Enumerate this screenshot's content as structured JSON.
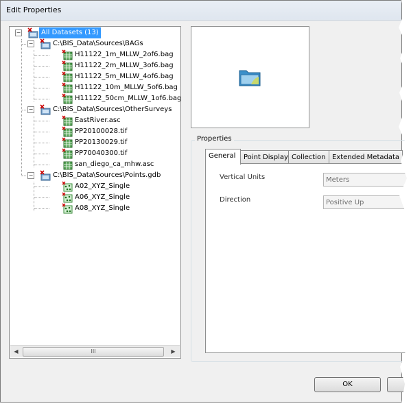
{
  "window": {
    "title": "Edit Properties"
  },
  "tree": {
    "root": {
      "label": "All Datasets (13)",
      "expanded": true,
      "selected": true
    },
    "groups": [
      {
        "label": "C:\\BIS_Data\\Sources\\BAGs",
        "expanded": true,
        "items": [
          "H11122_1m_MLLW_2of6.bag",
          "H11122_2m_MLLW_3of6.bag",
          "H11122_5m_MLLW_4of6.bag",
          "H11122_10m_MLLW_5of6.bag",
          "H11122_50cm_MLLW_1of6.bag"
        ],
        "item_icon": "raster-grid-icon"
      },
      {
        "label": "C:\\BIS_Data\\Sources\\OtherSurveys",
        "expanded": true,
        "items": [
          "EastRiver.asc",
          "PP20100028.tif",
          "PP20130029.tif",
          "PP70040300.tif",
          "san_diego_ca_mhw.asc"
        ],
        "item_icon": "raster-grid-icon"
      },
      {
        "label": "C:\\BIS_Data\\Sources\\Points.gdb",
        "expanded": true,
        "items": [
          "A02_XYZ_Single",
          "A06_XYZ_Single",
          "A08_XYZ_Single"
        ],
        "item_icon": "point-layer-icon"
      }
    ],
    "scrollbar_grip": "III"
  },
  "properties": {
    "group_title": "Properties",
    "tabs": [
      "General",
      "Point Display",
      "Collection",
      "Extended Metadata"
    ],
    "active_tab": 0,
    "fields": [
      {
        "label": "Vertical Units",
        "value": "Meters"
      },
      {
        "label": "Direction",
        "value": "Positive Up"
      }
    ]
  },
  "buttons": {
    "ok": "OK"
  },
  "colors": {
    "selection": "#3399ff",
    "dialog_bg": "#f0f0f0"
  }
}
